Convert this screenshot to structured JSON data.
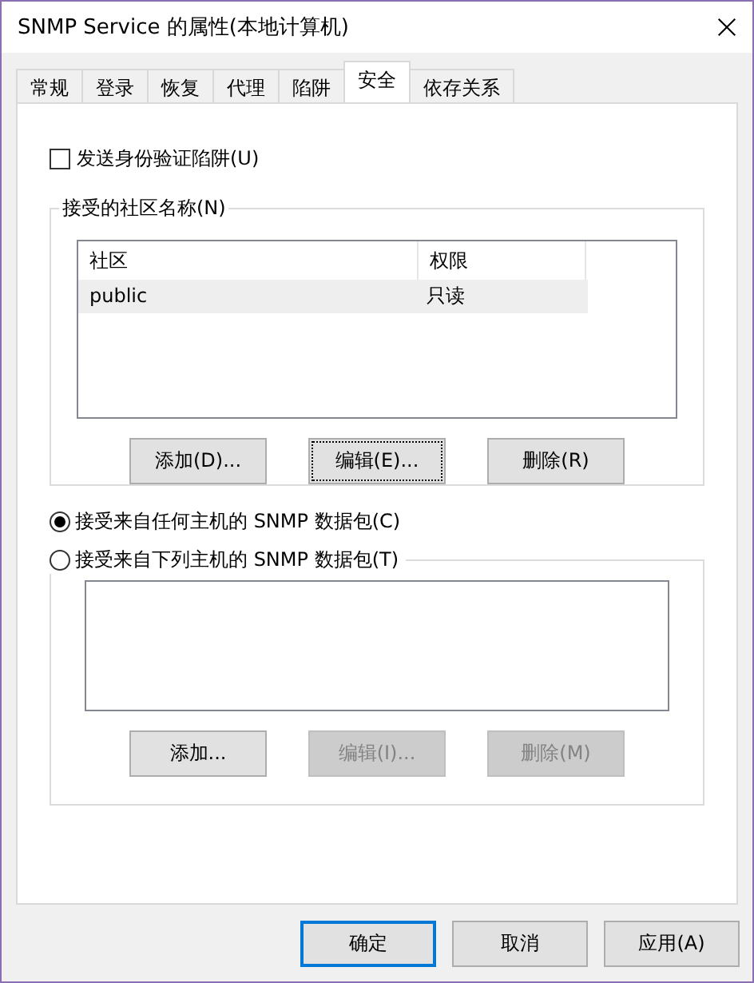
{
  "window": {
    "title": "SNMP Service 的属性(本地计算机)"
  },
  "tabs": [
    {
      "label": "常规",
      "selected": false
    },
    {
      "label": "登录",
      "selected": false
    },
    {
      "label": "恢复",
      "selected": false
    },
    {
      "label": "代理",
      "selected": false
    },
    {
      "label": "陷阱",
      "selected": false
    },
    {
      "label": "安全",
      "selected": true
    },
    {
      "label": "依存关系",
      "selected": false
    }
  ],
  "send_auth_trap": {
    "label": "发送身份验证陷阱(U)",
    "checked": false
  },
  "communities": {
    "title": "接受的社区名称(N)",
    "columns": [
      "社区",
      "权限"
    ],
    "rows": [
      {
        "cells": [
          "public",
          "只读"
        ],
        "selected": true
      }
    ],
    "buttons": [
      {
        "label": "添加(D)...",
        "disabled": false,
        "focused": false
      },
      {
        "label": "编辑(E)...",
        "disabled": false,
        "focused": true
      },
      {
        "label": "删除(R)",
        "disabled": false,
        "focused": false
      }
    ]
  },
  "hosts": {
    "options": [
      {
        "label": "接受来自任何主机的 SNMP 数据包(C)",
        "selected": true
      },
      {
        "label": "接受来自下列主机的 SNMP 数据包(T)",
        "selected": false
      }
    ],
    "buttons": [
      {
        "label": "添加...",
        "disabled": false,
        "focused": false
      },
      {
        "label": "编辑(I)...",
        "disabled": true,
        "focused": false
      },
      {
        "label": "删除(M)",
        "disabled": true,
        "focused": false
      }
    ]
  },
  "dialog_buttons": [
    {
      "label": "确定",
      "default": true
    },
    {
      "label": "取消",
      "default": false
    },
    {
      "label": "应用(A)",
      "default": false
    }
  ]
}
